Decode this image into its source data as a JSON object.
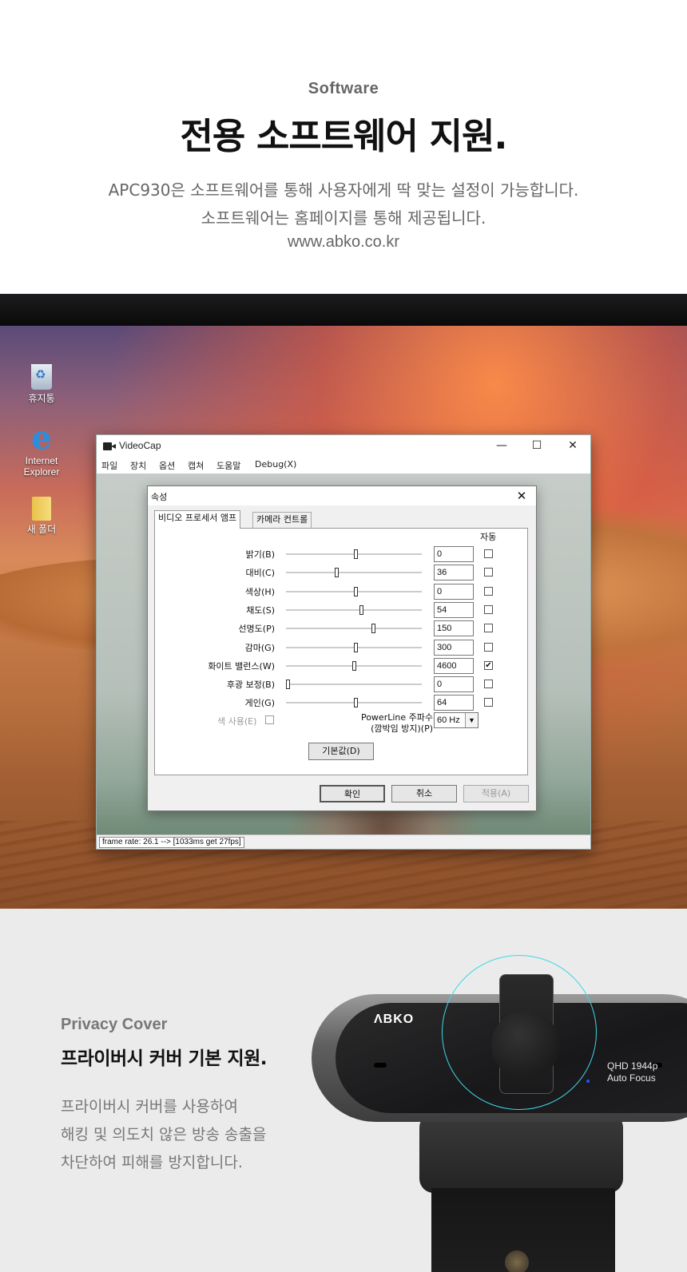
{
  "software": {
    "eyebrow": "Software",
    "title": "전용 소프트웨어 지원.",
    "desc_line1": "APC930은 소프트웨어를 통해 사용자에게 딱 맞는 설정이 가능합니다.",
    "desc_line2": "소프트웨어는 홈페이지를 통해 제공됩니다.",
    "url": "www.abko.co.kr"
  },
  "desktop": {
    "icons": [
      {
        "label": "휴지통",
        "icon": "recycle-bin-icon"
      },
      {
        "label": "Internet\nExplorer",
        "icon": "internet-explorer-icon"
      },
      {
        "label": "새 폴더",
        "icon": "folder-icon"
      }
    ]
  },
  "videocap": {
    "title": "VideoCap",
    "controls": {
      "minimize": "—",
      "maximize": "☐",
      "close": "✕"
    },
    "menu": [
      "파일",
      "장치",
      "옵션",
      "캡쳐",
      "도움말",
      "Debug(X)"
    ],
    "status": "frame rate: 26.1 --> [1033ms get 27fps]"
  },
  "properties": {
    "title": "속성",
    "close": "✕",
    "tabs": [
      "비디오 프로세서 앰프",
      "카메라 컨트롤"
    ],
    "auto_header": "자동",
    "rows": [
      {
        "label": "밝기(B)",
        "value": "0",
        "slider": 0.5,
        "auto": false
      },
      {
        "label": "대비(C)",
        "value": "36",
        "slider": 0.36,
        "auto": false
      },
      {
        "label": "색상(H)",
        "value": "0",
        "slider": 0.5,
        "auto": false
      },
      {
        "label": "채도(S)",
        "value": "54",
        "slider": 0.54,
        "auto": false
      },
      {
        "label": "선명도(P)",
        "value": "150",
        "slider": 0.63,
        "auto": false
      },
      {
        "label": "감마(G)",
        "value": "300",
        "slider": 0.5,
        "auto": false
      },
      {
        "label": "화이트 밸런스(W)",
        "value": "4600",
        "slider": 0.49,
        "auto": true
      },
      {
        "label": "후광 보정(B)",
        "value": "0",
        "slider": 0.0,
        "auto": false
      },
      {
        "label": "게인(G)",
        "value": "64",
        "slider": 0.5,
        "auto": false
      }
    ],
    "color_use": "색 사용(E)",
    "powerline_label_1": "PowerLine 주파수",
    "powerline_label_2": "(깜박임 방지)(P)",
    "powerline_value": "60 Hz",
    "dropdown_arrow": "▼",
    "defaults_button": "기본값(D)",
    "ok_button": "확인",
    "cancel_button": "취소",
    "apply_button": "적용(A)"
  },
  "privacy": {
    "eyebrow": "Privacy Cover",
    "title": "프라이버시 커버 기본 지원.",
    "desc_line1": "프라이버시 커버를 사용하여",
    "desc_line2": "해킹 및 의도치 않은 방송 송출을",
    "desc_line3": "차단하여 피해를 방지합니다.",
    "camera_logo": "ΛBKO",
    "camera_spec_1": "QHD 1944p",
    "camera_spec_2": "Auto Focus"
  },
  "colors": {
    "focus_ring": "#3fd7e6",
    "led": "#2a50ff"
  }
}
